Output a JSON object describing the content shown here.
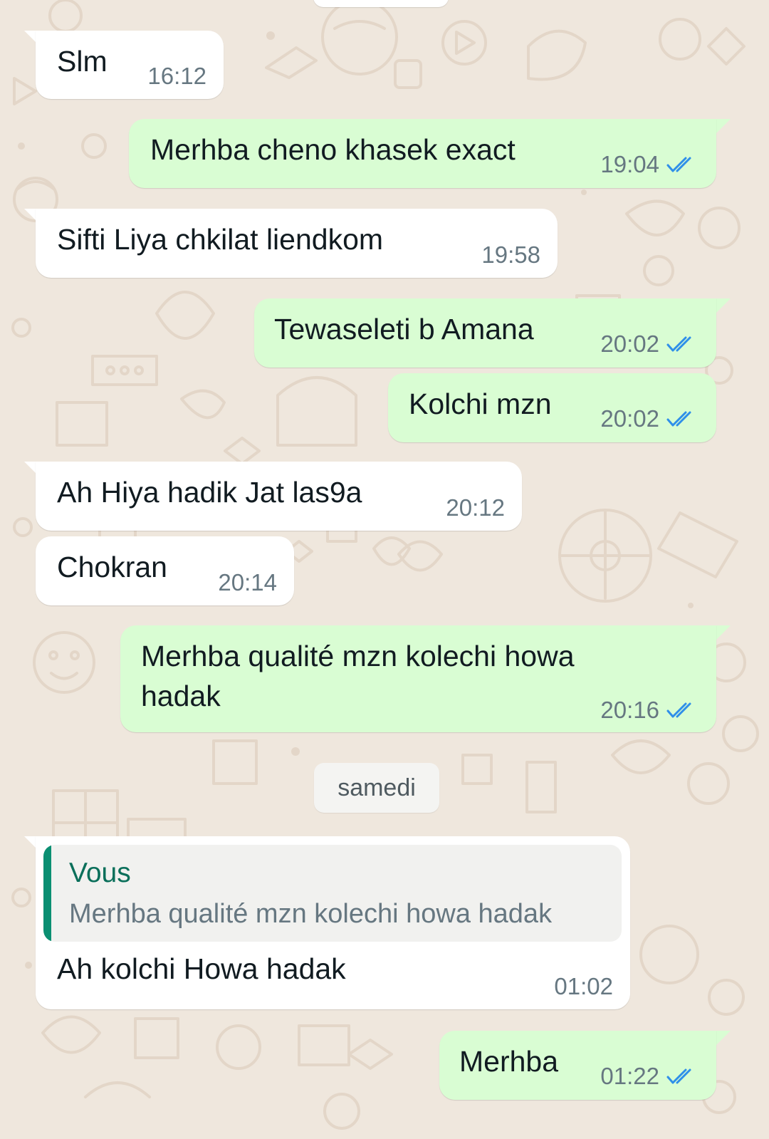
{
  "chat": {
    "messages": [
      {
        "id": "m1",
        "direction": "received",
        "text": "Slm",
        "time": "16:12"
      },
      {
        "id": "m2",
        "direction": "sent",
        "text": "Merhba cheno khasek exact",
        "time": "19:04",
        "status_icon": "double-check-icon"
      },
      {
        "id": "m3",
        "direction": "received",
        "text": "Sifti Liya chkilat liendkom",
        "time": "19:58"
      },
      {
        "id": "m4",
        "direction": "sent",
        "text": "Tewaseleti b Amana",
        "time": "20:02",
        "status_icon": "double-check-icon"
      },
      {
        "id": "m5",
        "direction": "sent",
        "text": "Kolchi mzn",
        "time": "20:02",
        "status_icon": "double-check-icon"
      },
      {
        "id": "m6",
        "direction": "received",
        "text": "Ah Hiya hadik Jat las9a",
        "time": "20:12"
      },
      {
        "id": "m7",
        "direction": "received",
        "text": "Chokran",
        "time": "20:14"
      },
      {
        "id": "m8",
        "direction": "sent",
        "text_line1": "Merhba qualité mzn kolechi howa",
        "text_line2": "hadak",
        "time": "20:16",
        "status_icon": "double-check-icon"
      },
      {
        "id": "m9",
        "direction": "received",
        "quote": {
          "author": "Vous",
          "text": "Merhba qualité mzn kolechi howa hadak"
        },
        "text": "Ah kolchi Howa hadak",
        "time": "01:02"
      },
      {
        "id": "m10",
        "direction": "sent",
        "text": "Merhba",
        "time": "01:22",
        "status_icon": "double-check-icon"
      }
    ],
    "date_separator": "samedi"
  },
  "colors": {
    "background": "#efe7dd",
    "incoming_bubble": "#ffffff",
    "outgoing_bubble": "#d9fdd3",
    "read_tick": "#2f8fe9",
    "quote_bar": "#0b8f72",
    "quote_author": "#0a6f5a"
  }
}
